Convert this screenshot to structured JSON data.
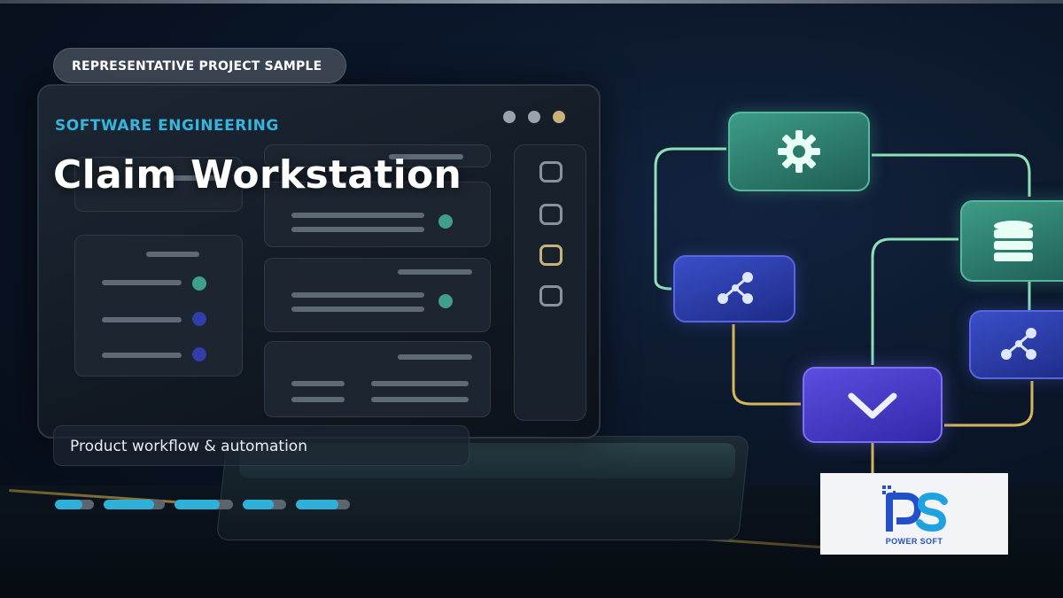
{
  "badge": {
    "label": "REPRESENTATIVE PROJECT SAMPLE"
  },
  "header": {
    "eyebrow": "SOFTWARE ENGINEERING",
    "title": "Claim Workstation"
  },
  "caption": {
    "text": "Product workflow & automation"
  },
  "progress": {
    "segments": [
      {
        "fill": 0.7
      },
      {
        "fill": 0.82
      },
      {
        "fill": 0.78
      },
      {
        "fill": 0.72
      },
      {
        "fill": 0.78
      }
    ]
  },
  "logo": {
    "brand": "POWER SOFT",
    "mark": "PS"
  },
  "colors": {
    "accent": "#36b5dc",
    "progress_fill": "#2fb0d8",
    "progress_track": "#5a6570",
    "brand_blue": "#2350c6"
  },
  "icons": {
    "settings": "gear-icon",
    "database": "database-icon",
    "network": "network-icon",
    "check": "chevron-check-icon"
  }
}
